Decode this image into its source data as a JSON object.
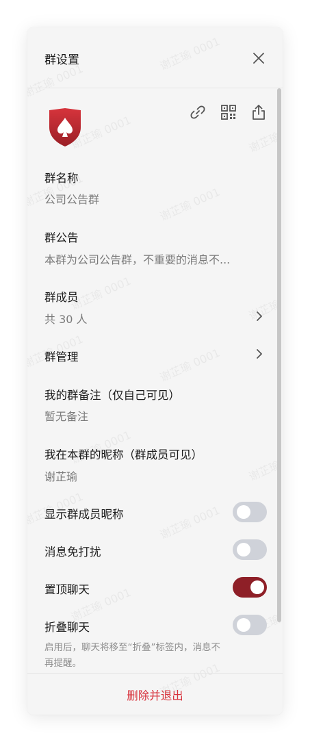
{
  "header": {
    "title": "群设置",
    "close_icon": "close-icon"
  },
  "watermark": "谢芷瑜 0001",
  "group": {
    "avatar_icon": "shield-spade-icon",
    "actions": [
      "link-icon",
      "qrcode-icon",
      "share-icon"
    ]
  },
  "info": {
    "name_label": "群名称",
    "name_value": "公司公告群",
    "notice_label": "群公告",
    "notice_value": "本群为公司公告群，不重要的消息不...",
    "members_label": "群成员",
    "members_value": "共 30 人",
    "manage_label": "群管理",
    "remark_label": "我的群备注（仅自己可见）",
    "remark_value": "暂无备注",
    "nickname_label": "我在本群的昵称（群成员可见）",
    "nickname_value": "谢芷瑜"
  },
  "toggles": {
    "show_nicknames": {
      "label": "显示群成员昵称",
      "on": false
    },
    "do_not_disturb": {
      "label": "消息免打扰",
      "on": false
    },
    "pin_chat": {
      "label": "置顶聊天",
      "on": true
    },
    "fold_chat": {
      "label": "折叠聊天",
      "on": false
    },
    "fold_hint": "启用后，聊天将移至“折叠”标签内，消息不再提醒。"
  },
  "colors": {
    "accent": "#8e1f27",
    "danger": "#d8343e",
    "toggle_off": "#cfd2d9"
  },
  "footer": {
    "delete_label": "删除并退出"
  }
}
